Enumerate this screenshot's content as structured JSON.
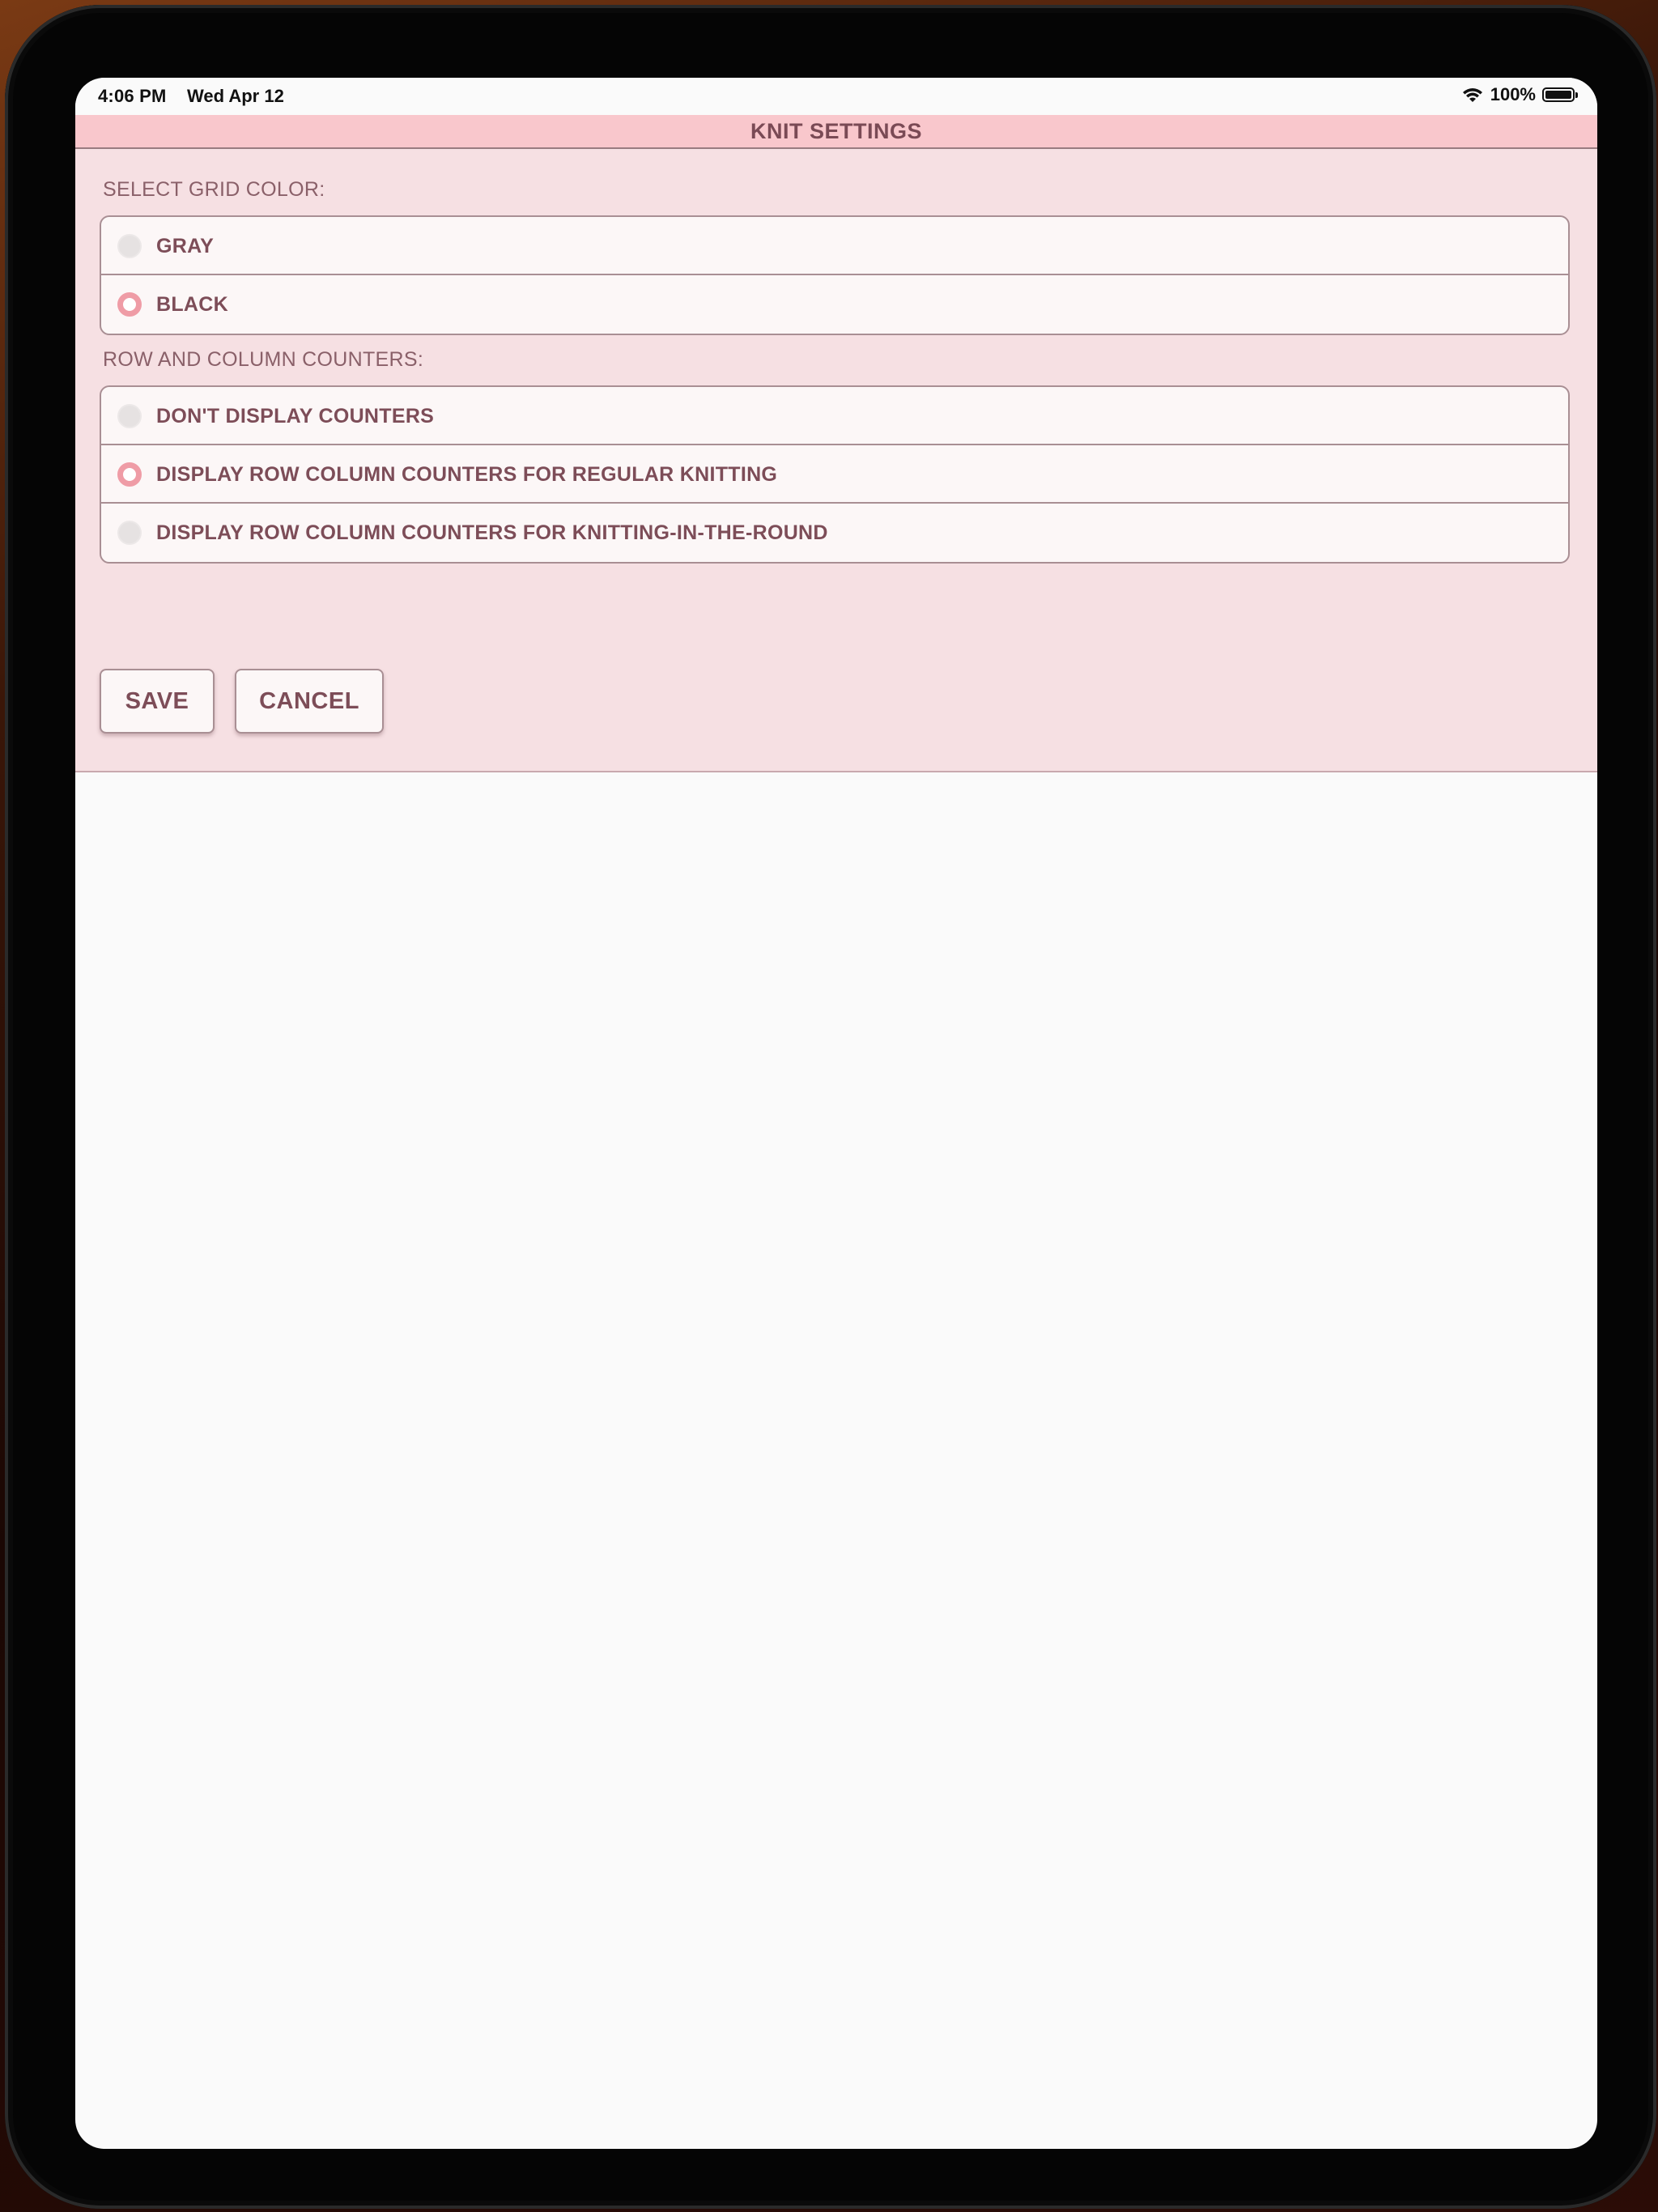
{
  "status_bar": {
    "time": "4:06 PM",
    "date": "Wed Apr 12",
    "battery": "100%",
    "battery_level": 1.0
  },
  "header": {
    "title": "KNIT SETTINGS"
  },
  "grid_color": {
    "label": "SELECT GRID COLOR:",
    "options": [
      {
        "label": "GRAY",
        "selected": false
      },
      {
        "label": "BLACK",
        "selected": true
      }
    ]
  },
  "counters": {
    "label": "ROW AND COLUMN COUNTERS:",
    "options": [
      {
        "label": "DON'T DISPLAY COUNTERS",
        "selected": false
      },
      {
        "label": "DISPLAY ROW COLUMN COUNTERS FOR REGULAR KNITTING",
        "selected": true
      },
      {
        "label": "DISPLAY ROW COLUMN COUNTERS FOR KNITTING-IN-THE-ROUND",
        "selected": false
      }
    ]
  },
  "actions": {
    "save_label": "SAVE",
    "cancel_label": "CANCEL"
  },
  "colors": {
    "title_bar": "#f9c7cc",
    "panel": "#f6e0e3",
    "text": "#7d4d58",
    "radio_accent": "#ef9ca6",
    "content_bg": "#fafafa"
  }
}
